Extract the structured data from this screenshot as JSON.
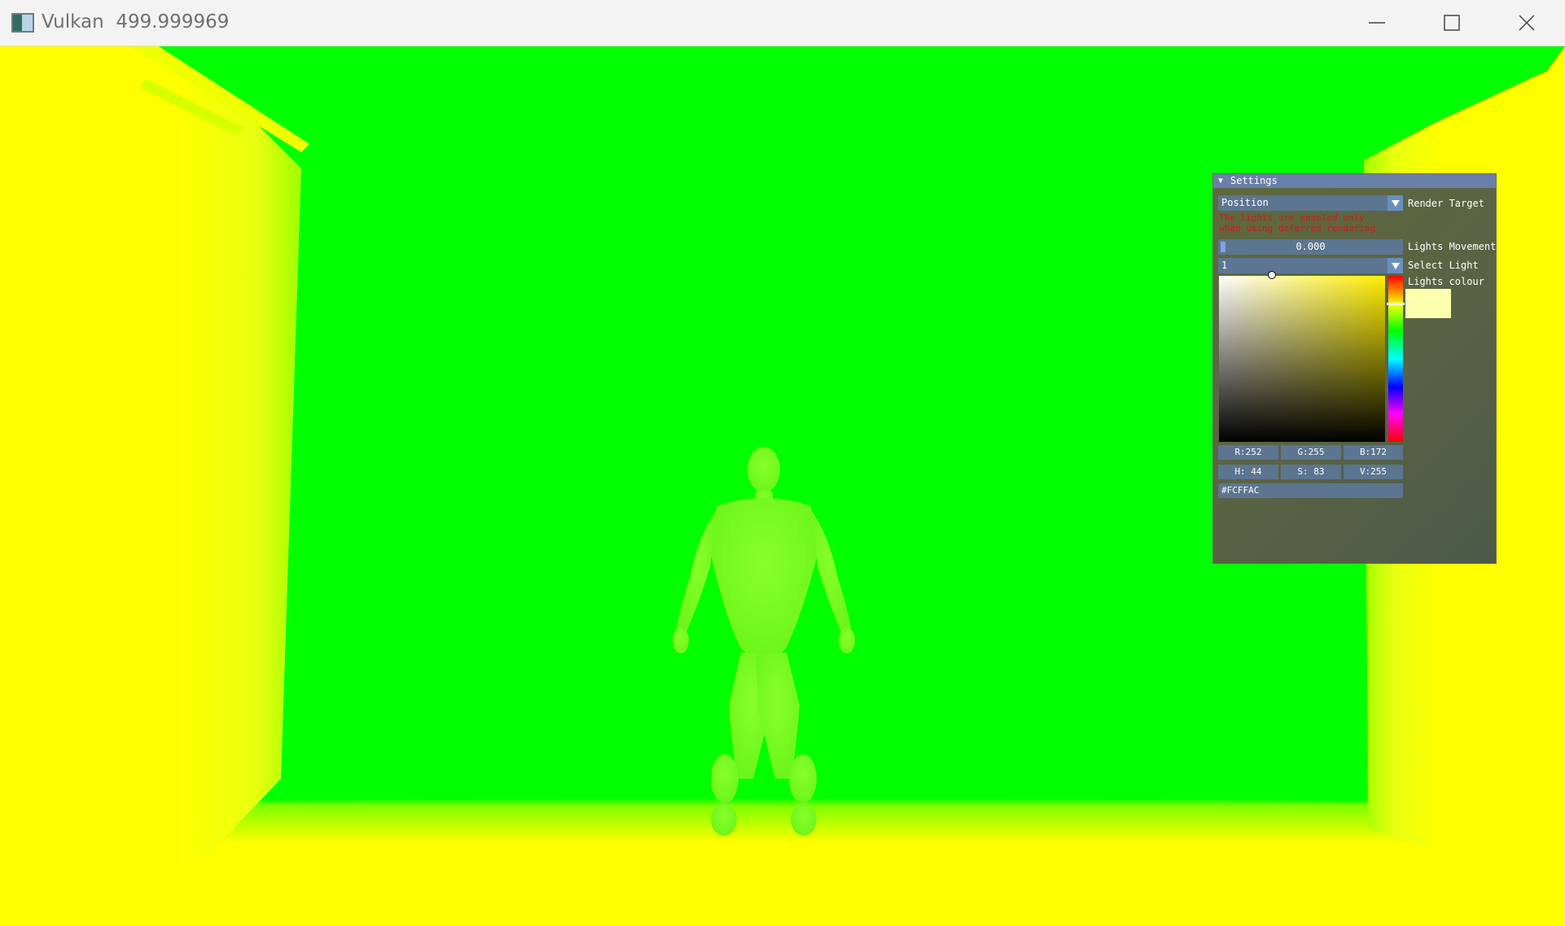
{
  "window": {
    "title": "Vulkan  499.999969",
    "controls": {
      "minimize": "minimize-icon",
      "maximize": "maximize-icon",
      "close": "close-icon"
    }
  },
  "scene": {
    "description_colors": {
      "background": "#00ff00",
      "walls": "#ffff00",
      "figure": "#7aff20"
    }
  },
  "settings": {
    "header": "Settings",
    "render_target": {
      "value": "Position",
      "label": "Render Target"
    },
    "warning": "The lights are enabled only when using deferred rendering",
    "lights_movement": {
      "value": "0.000",
      "label": "Lights Movement"
    },
    "select_light": {
      "value": "1",
      "label": "Select Light"
    },
    "lights_colour": {
      "label": "Lights colour",
      "swatch": "#FCFFAC",
      "r": "R:252",
      "g": "G:255",
      "b": "B:172",
      "h": "H: 44",
      "s": "S: 83",
      "v": "V:255",
      "hex": "#FCFFAC"
    }
  },
  "colors": {
    "accent": "#6a80a8",
    "frame": "#5c7691",
    "warning": "#d01818"
  }
}
